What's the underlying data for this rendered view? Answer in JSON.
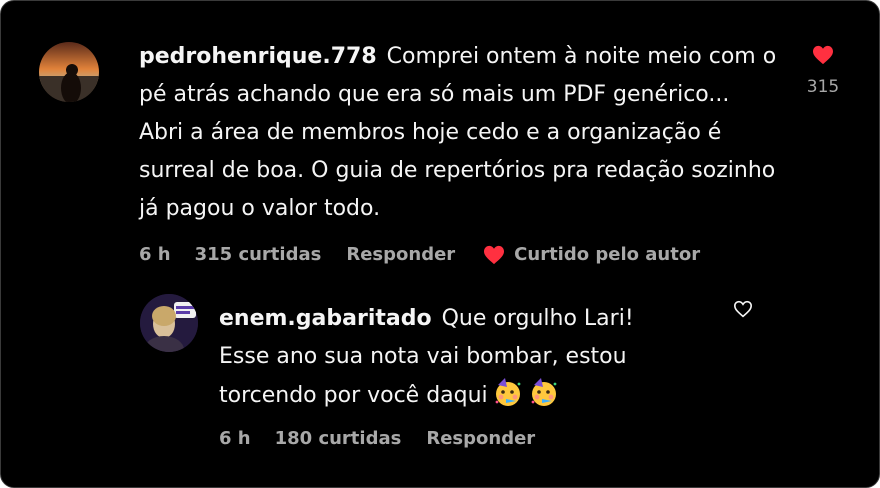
{
  "comment": {
    "username": "pedrohenrique.778",
    "text": "Comprei ontem à noite meio com o pé atrás achando que era só mais um PDF genérico... Abri a área de membros hoje cedo e a organização é surreal de boa. O guia de repertórios pra redação sozinho já pagou o valor todo.",
    "time": "6 h",
    "likes_label": "315 curtidas",
    "reply_label": "Responder",
    "liked_by_author": "Curtido pelo autor",
    "like_count": "315",
    "liked": true,
    "avatar_icon": "sunset-silhouette-avatar"
  },
  "reply": {
    "username": "enem.gabaritado",
    "text": "Que orgulho Lari! Esse ano sua nota vai bombar, estou torcendo por você daqui",
    "emojis": [
      "partying-face-emoji",
      "partying-face-emoji"
    ],
    "time": "6 h",
    "likes_label": "180 curtidas",
    "reply_label": "Responder",
    "liked": false,
    "avatar_icon": "profile-photo-avatar"
  },
  "colors": {
    "background": "#000000",
    "text": "#f5f5f5",
    "secondary": "#a8a8a8",
    "heart": "#ff3040"
  }
}
